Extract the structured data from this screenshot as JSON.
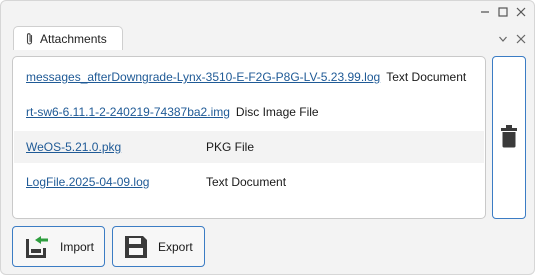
{
  "window": {
    "controls": [
      "minimize-icon",
      "maximize-icon",
      "close-icon"
    ]
  },
  "tab": {
    "label": "Attachments",
    "icon": "paperclip-icon"
  },
  "tab_controls": [
    "chevron-down-icon",
    "close-icon"
  ],
  "attachments": [
    {
      "name": "messages_afterDowngrade-Lynx-3510-E-F2G-P8G-LV-5.23.99.log",
      "type": "Text Document"
    },
    {
      "name": "rt-sw6-6.11.1-2-240219-74387ba2.img",
      "type": "Disc Image File"
    },
    {
      "name": "WeOS-5.21.0.pkg",
      "type": "PKG File"
    },
    {
      "name": "LogFile.2025-04-09.log",
      "type": "Text Document"
    }
  ],
  "buttons": {
    "import_label": "Import",
    "export_label": "Export",
    "delete_icon": "trash-icon"
  },
  "colors": {
    "link": "#1f5a96",
    "accent_border": "#3b7cc4",
    "icon_dark": "#3a3a3a",
    "import_arrow": "#2e9e3e"
  }
}
